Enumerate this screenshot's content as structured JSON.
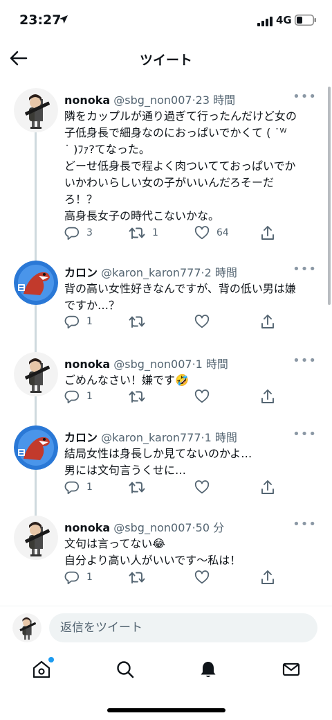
{
  "status_bar": {
    "time": "23:27",
    "network": "4G"
  },
  "header": {
    "title": "ツイート"
  },
  "tweets": [
    {
      "name": "nonoka",
      "handle": "@sbg_non007",
      "time": "23 時間",
      "avatar": "soldier-avatar",
      "lines": [
        "隣をカップルが通り過ぎて行ったんだけど女の",
        "子低身長で細身なのにおっぱいでかくて ( ˙ᵂ",
        "˙ )ﾌｧ?てなった。",
        "どーせ低身長で程よく肉ついてておっぱいでか",
        "いかわいらしい女の子がいいんだろそーだ",
        "ろ！？",
        "高身長女子の時代こないかな。"
      ],
      "reply_count": "3",
      "retweet_count": "1",
      "like_count": "64"
    },
    {
      "name": "カロン",
      "handle": "@karon_karon777",
      "time": "2 時間",
      "avatar": "dinosaur-avatar",
      "lines": [
        "背の高い女性好きなんですが、背の低い男は嫌",
        "ですか…？"
      ],
      "reply_count": "1",
      "retweet_count": "",
      "like_count": ""
    },
    {
      "name": "nonoka",
      "handle": "@sbg_non007",
      "time": "1 時間",
      "avatar": "soldier-avatar",
      "lines": [
        "ごめんなさい！嫌です🤣"
      ],
      "reply_count": "1",
      "retweet_count": "",
      "like_count": ""
    },
    {
      "name": "カロン",
      "handle": "@karon_karon777",
      "time": "1 時間",
      "avatar": "dinosaur-avatar",
      "lines": [
        "結局女性は身長しか見てないのかよ…",
        "男には文句言うくせに…"
      ],
      "reply_count": "1",
      "retweet_count": "",
      "like_count": ""
    },
    {
      "name": "nonoka",
      "handle": "@sbg_non007",
      "time": "50 分",
      "avatar": "soldier-avatar",
      "lines": [
        "文句は言ってない😂",
        "自分より高い人がいいです～私は！"
      ],
      "reply_count": "1",
      "retweet_count": "",
      "like_count": ""
    }
  ],
  "reply_box": {
    "placeholder": "返信をツイート"
  },
  "tabs": [
    "home-icon",
    "search-icon",
    "bell-icon",
    "mail-icon"
  ],
  "colors": {
    "accent": "#1d9bf0",
    "secondary_text": "#536471"
  }
}
